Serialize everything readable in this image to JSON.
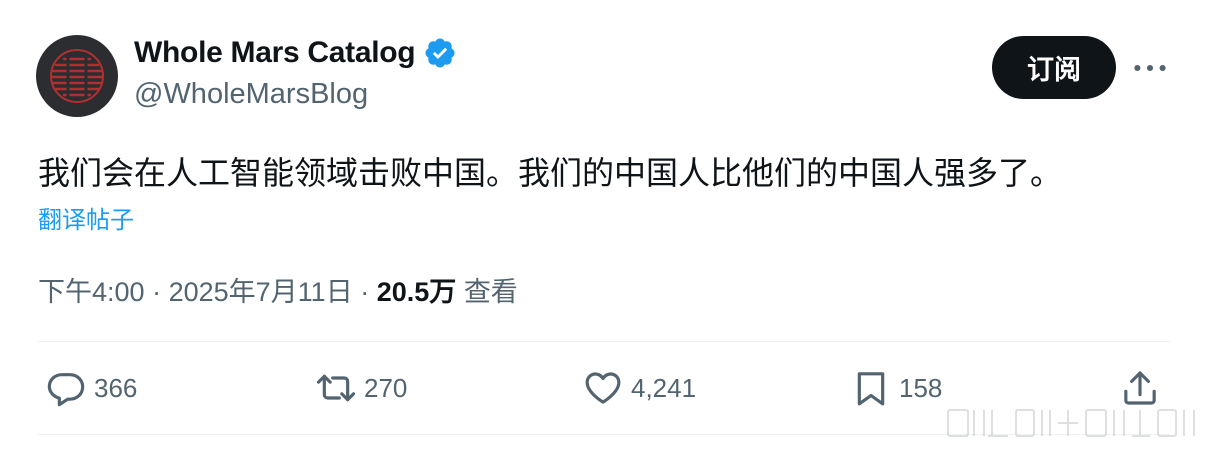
{
  "author": {
    "display_name": "Whole Mars Catalog",
    "handle": "@WholeMarsBlog",
    "verified": true
  },
  "header": {
    "subscribe_label": "订阅",
    "more_icon": "more-horizontal-icon"
  },
  "tweet": {
    "text": "我们会在人工智能领域击败中国。我们的中国人比他们的中国人强多了。",
    "translate_label": "翻译帖子"
  },
  "meta": {
    "time": "下午4:00",
    "separator": "·",
    "date": "2025年7月11日",
    "views_count": "20.5万",
    "views_label": "查看"
  },
  "actions": {
    "reply": {
      "icon": "reply-icon",
      "count": "366"
    },
    "retweet": {
      "icon": "retweet-icon",
      "count": "270"
    },
    "like": {
      "icon": "heart-icon",
      "count": "4,241"
    },
    "bookmark": {
      "icon": "bookmark-icon",
      "count": "158"
    },
    "share": {
      "icon": "share-icon"
    }
  },
  "colors": {
    "text_primary": "#0f1419",
    "text_secondary": "#536471",
    "link": "#1d9bf0",
    "verified": "#1d9bf0",
    "avatar_bg": "#2b2d30",
    "avatar_accent": "#c0392b"
  }
}
